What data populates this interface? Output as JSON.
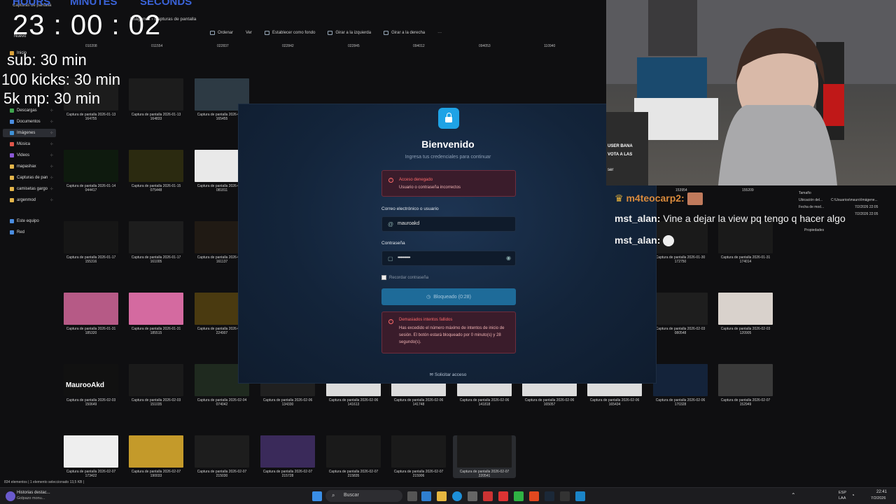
{
  "overlay": {
    "labels": {
      "hours": "HOURS",
      "minutes": "MINUTES",
      "seconds": "SECONDS"
    },
    "timer": "23 : 00 : 02",
    "goals": [
      "sub: 30 min",
      "100 kicks: 30 min",
      "5k mp: 30 min"
    ]
  },
  "explorer": {
    "breadcrumb": "Imágenes  ›  Capturas de pantalla",
    "window_title": "Capturas de pantalla",
    "new_button": "Nuevo",
    "toolbar": [
      "Ordenar",
      "Ver",
      "Establecer como fondo",
      "Girar a la izquierda",
      "Girar a la derecha",
      "···"
    ],
    "top_numbers": [
      "010208",
      "011554",
      "022837",
      "022842",
      "022845",
      "094012",
      "094053",
      "110940"
    ],
    "sidebar": [
      {
        "label": "Inicio",
        "icon": "home-icon",
        "color": "#d9a13b"
      },
      {
        "label": "Descargas",
        "icon": "download-icon",
        "color": "#3fa34d"
      },
      {
        "label": "Documentos",
        "icon": "document-icon",
        "color": "#4a8de0"
      },
      {
        "label": "Imágenes",
        "icon": "image-icon",
        "color": "#3f92d8"
      },
      {
        "label": "Música",
        "icon": "music-icon",
        "color": "#e0564a"
      },
      {
        "label": "Videos",
        "icon": "video-icon",
        "color": "#8b58d6"
      },
      {
        "label": "mapashax",
        "icon": "folder-icon",
        "color": "#e4b54a"
      },
      {
        "label": "Capturas de pan",
        "icon": "folder-icon",
        "color": "#e4b54a"
      },
      {
        "label": "camisetas gargo",
        "icon": "folder-icon",
        "color": "#e4b54a"
      },
      {
        "label": "argenmod",
        "icon": "folder-icon",
        "color": "#e4b54a"
      },
      {
        "label": "Este equipo",
        "icon": "computer-icon",
        "color": "#4a8de0"
      },
      {
        "label": "Red",
        "icon": "network-icon",
        "color": "#4a8de0"
      }
    ],
    "thumbnails": [
      {
        "name": "Captura de pantalla 2026-01-13",
        "time": "164755",
        "color": "#1c1c1c"
      },
      {
        "name": "Captura de pantalla 2026-01-13",
        "time": "164833",
        "color": "#1c1c1c"
      },
      {
        "name": "Captura de pantalla 2026-01-13",
        "time": "165455",
        "color": "#2d3a44"
      },
      {
        "name": "Captura de pantalla 2026-01-14",
        "time": "044417",
        "color": "#0e1a0e"
      },
      {
        "name": "Captura de pantalla 2026-01-15",
        "time": "075448",
        "color": "#2b2a10"
      },
      {
        "name": "Captura de pantalla 2026-01-16",
        "time": "081811",
        "color": "#e9e9e9"
      },
      {
        "name": "Captura de pantalla 2026-01-17",
        "time": "155316",
        "color": "#161616"
      },
      {
        "name": "Captura de pantalla 2026-01-17",
        "time": "161005",
        "color": "#1d1d1d"
      },
      {
        "name": "Captura de pantalla 2026-01-17",
        "time": "161137",
        "color": "#201a14"
      },
      {
        "name": "Captura de pantalla 2026-01-31",
        "time": "185320",
        "color": "#b65a86"
      },
      {
        "name": "Captura de pantalla 2026-01-31",
        "time": "185515",
        "color": "#d46aa0"
      },
      {
        "name": "Captura de pantalla 2026-01-31",
        "time": "224907",
        "color": "#4a3a10"
      },
      {
        "name": "Captura de pantalla 2026-02-03",
        "time": "150649",
        "color": "#111111"
      },
      {
        "name": "Captura de pantalla 2026-02-03",
        "time": "151035",
        "color": "#1a1a1a"
      },
      {
        "name": "Captura de pantalla 2026-02-04",
        "time": "074042",
        "color": "#1f2a1f"
      },
      {
        "name": "Captura de pantalla 2026-02-06",
        "time": "134330",
        "color": "#202020"
      },
      {
        "name": "Captura de pantalla 2026-02-06",
        "time": "141613",
        "color": "#dcdcdc"
      },
      {
        "name": "Captura de pantalla 2026-02-06",
        "time": "141748",
        "color": "#dcdcdc"
      },
      {
        "name": "Captura de pantalla 2026-02-06",
        "time": "141818",
        "color": "#dcdcdc"
      },
      {
        "name": "Captura de pantalla 2026-02-06",
        "time": "165057",
        "color": "#dcdcdc"
      },
      {
        "name": "Captura de pantalla 2026-02-06",
        "time": "165434",
        "color": "#dcdcdc"
      },
      {
        "name": "Captura de pantalla 2026-02-06",
        "time": "170328",
        "color": "#14233a"
      },
      {
        "name": "Captura de pantalla 2026-02-07",
        "time": "152949",
        "color": "#3a3a3a"
      },
      {
        "name": "Captura de pantalla 2026-02-07",
        "time": "173422",
        "color": "#eeeeee"
      },
      {
        "name": "Captura de pantalla 2026-02-07",
        "time": "190033",
        "color": "#c49a2a"
      },
      {
        "name": "Captura de pantalla 2026-02-07",
        "time": "215030",
        "color": "#1d1d1d"
      },
      {
        "name": "Captura de pantalla 2026-02-07",
        "time": "215728",
        "color": "#3a2a5a"
      },
      {
        "name": "Captura de pantalla 2026-02-07",
        "time": "215835",
        "color": "#1a1a1a"
      },
      {
        "name": "Captura de pantalla 2026-02-07",
        "time": "215906",
        "color": "#1a1a1a"
      },
      {
        "name": "Captura de pantalla 2026-02-07",
        "time": "220541",
        "color": "#1a1a1a"
      },
      {
        "name": "Captura de pantalla 2026-01-30",
        "time": "172750",
        "color": "#1a1a1a"
      },
      {
        "name": "Captura de pantalla 2026-01-31",
        "time": "174014",
        "color": "#1a1a1a"
      },
      {
        "name": "Captura de pantalla 2026-02-03",
        "time": "080548",
        "color": "#1e1e1e"
      },
      {
        "name": "Captura de pantalla 2026-02-03",
        "time": "120905",
        "color": "#d9d2cc"
      }
    ],
    "right_pane": {
      "size_label": "Tamaño",
      "location_label": "Ubicación del...",
      "location_value": "C:\\Usuarios\\mauro\\Imágene...",
      "date_label": "Fecha de mod...",
      "date_value": "7/2/2026 22:05",
      "date2_value": "7/2/2026 22:05",
      "properties": "Propiedades",
      "num1": "153954",
      "num2": "155209"
    },
    "thumb_brand": "MauroоAkd",
    "status": "834 elementos  |  1 elemento seleccionado  13,5 KB  |"
  },
  "dialog": {
    "title": "Bienvenido",
    "subtitle": "Ingresa tus credenciales para continuar",
    "alert1": {
      "title": "Acceso denegado",
      "body": "Usuario o contraseña incorrectos"
    },
    "email_label": "Correo electrónico o usuario",
    "email_value": "mauroakd",
    "password_label": "Contraseña",
    "password_value": "••••••••••••",
    "remember_label": "Recordar contraseña",
    "button_label": "Bloqueado (0:28)",
    "alert2": {
      "title": "Demasiados intentos fallidos",
      "body": "Has excedido el número máximo de intentos de inicio de sesión. El botón estará bloqueado por 0 minuto(s) y 28 segundo(s)."
    },
    "request_access": "Solicitar acceso"
  },
  "cam_text": {
    "line1": "USER BANA",
    "line2": "VOTA A LAS",
    "line3": "ser"
  },
  "chat": [
    {
      "user": "m4teocarp2:",
      "text": "",
      "color": "#d98a3c"
    },
    {
      "user": "mst_alan:",
      "text": "Vine a dejar la view pq tengo q hacer algo",
      "color": "#f1f1f1"
    },
    {
      "user": "mst_alan:",
      "text": "",
      "color": "#f1f1f1"
    }
  ],
  "taskbar": {
    "widget_title": "Historias destac...",
    "widget_sub": "Golpazo monu...",
    "search_placeholder": "Buscar",
    "lang": "ESP",
    "lang2": "LAA",
    "time": "22:41",
    "date": "7/2/2026"
  }
}
